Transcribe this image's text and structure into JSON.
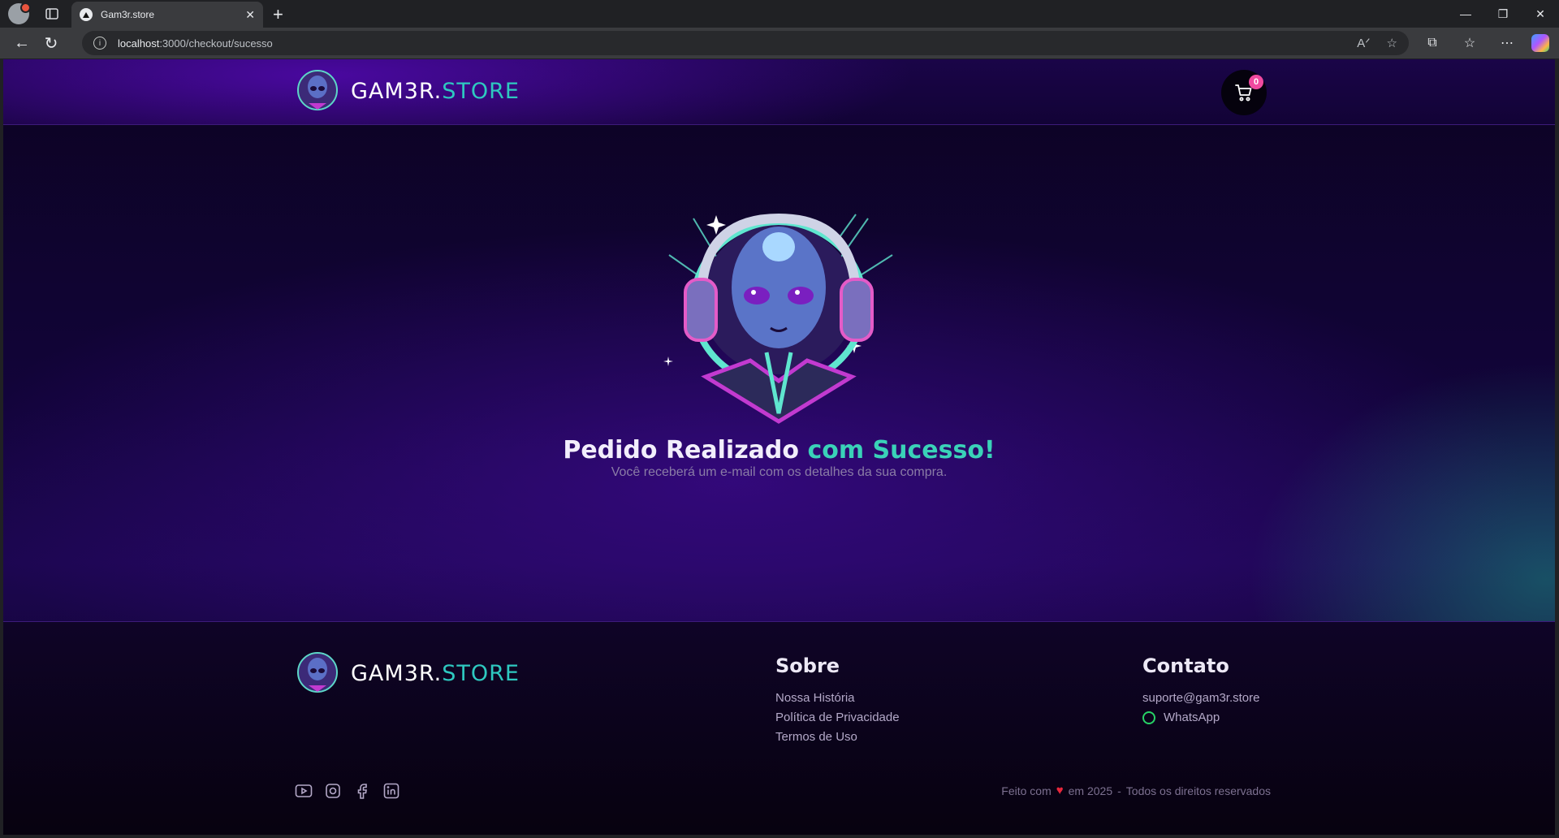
{
  "browser": {
    "tab_title": "Gam3r.store",
    "url_host": "localhost",
    "url_path": ":3000/checkout/sucesso"
  },
  "header": {
    "brand_primary": "GAM3R.",
    "brand_accent": "STORE",
    "cart_count": "0"
  },
  "hero": {
    "title_part1": "Pedido Realizado",
    "title_part2": "com Sucesso!",
    "subtitle": "Você receberá um e-mail com os detalhes da sua compra."
  },
  "footer": {
    "brand_primary": "GAM3R.",
    "brand_accent": "STORE",
    "sobre": {
      "heading": "Sobre",
      "links": [
        "Nossa História",
        "Política de Privacidade",
        "Termos de Uso"
      ]
    },
    "contato": {
      "heading": "Contato",
      "email": "suporte@gam3r.store",
      "whatsapp": "WhatsApp"
    },
    "socials": [
      "youtube-icon",
      "instagram-icon",
      "facebook-icon",
      "linkedin-icon"
    ],
    "copyright": {
      "made_with": "Feito com",
      "year": "em 2025",
      "separator": "-",
      "rights": "Todos os direitos reservados"
    }
  },
  "colors": {
    "accent_teal": "#2ec9c0",
    "badge_pink": "#f04aa0",
    "background": "#12043a"
  }
}
